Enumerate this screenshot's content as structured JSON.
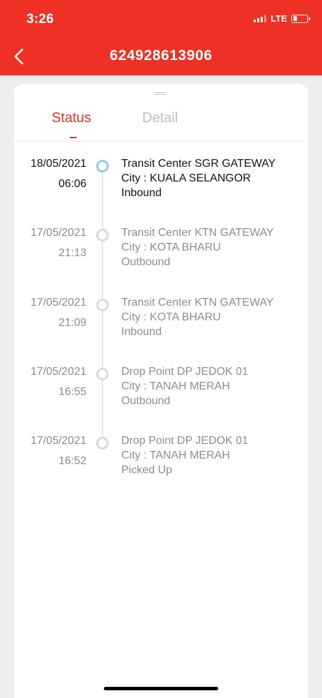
{
  "status_bar": {
    "time": "3:26",
    "network": "LTE"
  },
  "header": {
    "title": "624928613906"
  },
  "tabs": [
    {
      "label": "Status",
      "active": true
    },
    {
      "label": "Detail",
      "active": false
    }
  ],
  "events": [
    {
      "date": "18/05/2021",
      "time": "06:06",
      "line1": "Transit Center SGR GATEWAY",
      "line2": "City : KUALA SELANGOR",
      "line3": "Inbound",
      "active": true
    },
    {
      "date": "17/05/2021",
      "time": "21:13",
      "line1": "Transit Center KTN GATEWAY",
      "line2": "City : KOTA BHARU",
      "line3": "Outbound",
      "active": false
    },
    {
      "date": "17/05/2021",
      "time": "21:09",
      "line1": "Transit Center KTN GATEWAY",
      "line2": "City : KOTA BHARU",
      "line3": "Inbound",
      "active": false
    },
    {
      "date": "17/05/2021",
      "time": "16:55",
      "line1": "Drop Point DP JEDOK 01",
      "line2": "City : TANAH MERAH",
      "line3": "Outbound",
      "active": false
    },
    {
      "date": "17/05/2021",
      "time": "16:52",
      "line1": "Drop Point DP JEDOK 01",
      "line2": "City : TANAH MERAH",
      "line3": "Picked Up",
      "active": false
    }
  ],
  "colors": {
    "brand_red": "#ee3124",
    "active_dot": "#8ec9e9",
    "inactive_dot": "#d9d9d9",
    "muted_text": "#8c8c8c"
  },
  "icons": {
    "back": "chevron-left-icon",
    "signal": "signal-icon",
    "battery": "battery-icon"
  }
}
